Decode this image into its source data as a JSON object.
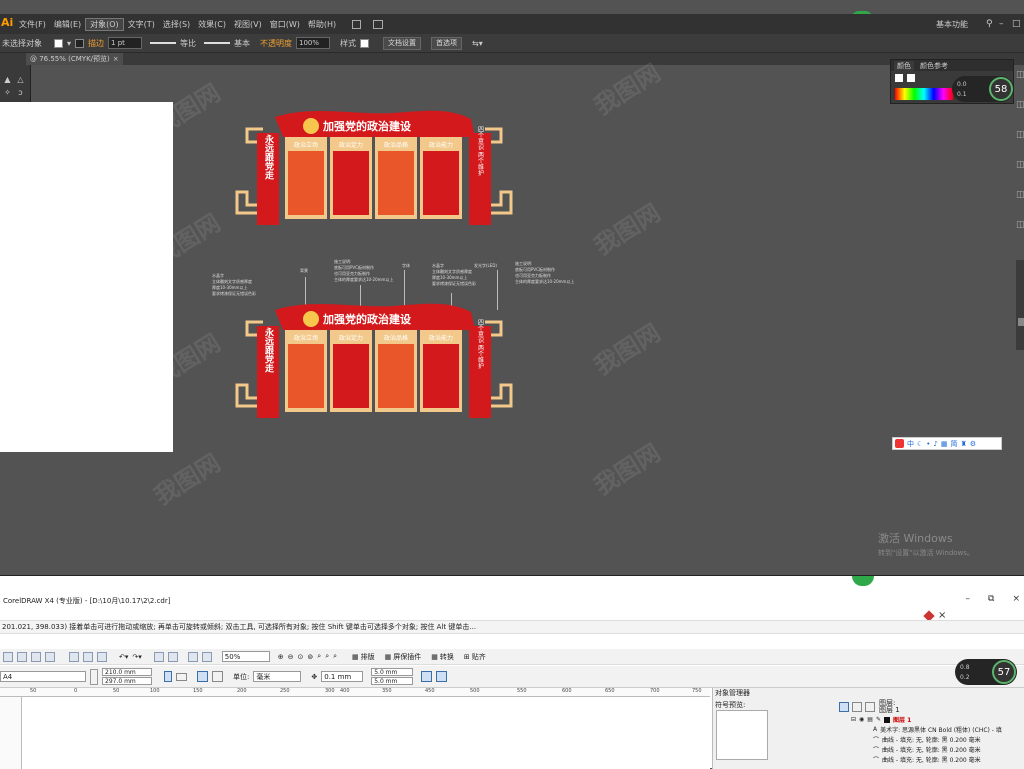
{
  "illustrator": {
    "logo": "Ai",
    "menu": [
      "文件(F)",
      "编辑(E)",
      "对象(O)",
      "文字(T)",
      "选择(S)",
      "效果(C)",
      "视图(V)",
      "窗口(W)",
      "帮助(H)"
    ],
    "workspace": "基本功能",
    "control_bar": {
      "selection": "未选择对象",
      "stroke_label": "描边",
      "stroke_weight": "1 pt",
      "profile": "等比",
      "brush": "基本",
      "opacity_label": "不透明度",
      "opacity_value": "100%",
      "style_label": "样式",
      "doc_setup": "文档设置",
      "prefs": "首选项"
    },
    "doc_tab": "@ 76.55% (CMYK/预览)",
    "panel": {
      "tabs": [
        "颜色",
        "颜色参考"
      ],
      "rows": [
        "0.0",
        "0.1"
      ],
      "gauge": "58"
    },
    "ime_bar": "中",
    "ime_bar_extra": "简",
    "activate": {
      "title": "激活 Windows",
      "subtitle": "转到\"设置\"以激活 Windows。"
    },
    "design": {
      "header": "加强党的政治建设",
      "left_pillar": "永远跟党走",
      "right_pillar": "四个意识 两个维护",
      "panels": [
        "政治立场",
        "政治定力",
        "政治品格",
        "政治能力"
      ]
    },
    "annotations": [
      {
        "text": "水晶字\n立体雕刻文字质感厚度\n厚度10-30mm以上\n要求烤漆保证无错误色彩"
      },
      {
        "text": "背景"
      },
      {
        "text": "施工说明:\n底板可用PVC板材制作\n也可用亚克力板制作\n主体的厚度要求达10-20mm以上"
      },
      {
        "text": "字体"
      },
      {
        "text": "水晶字\n立体雕刻文字质感厚度\n厚度10-30mm以上\n要求烤漆保证无错误色彩"
      },
      {
        "text": "发光字(LED)"
      },
      {
        "text": "施工说明:\n底板可用PVC板材制作\n也可用亚克力板制作\n主体的厚度要求达10-20mm以上"
      }
    ]
  },
  "corel": {
    "title": "CorelDRAW X4 (专业版) - [D:\\10月\\10.17\\2\\2.cdr]",
    "status": "201.021, 398.033)    接着单击可进行拖动或缩放; 再单击可旋转或倾斜; 双击工具, 可选择所有对象; 按住 Shift 键单击可选择多个对象; 按住 Alt 键单击...",
    "zoom": "50%",
    "tb_labels": [
      "排版",
      "屏保插件",
      "转换",
      "贴齐"
    ],
    "page_size": "A4",
    "width": "210.0 mm",
    "height": "297.0 mm",
    "unit_label": "单位:",
    "unit": "毫米",
    "nudge": "0.1 mm",
    "dup_x": "5.0 mm",
    "dup_y": "5.0 mm",
    "ruler_ticks": [
      "50",
      "0",
      "50",
      "100",
      "150",
      "200",
      "250",
      "300",
      "350",
      "400",
      "450",
      "500",
      "550",
      "600",
      "650",
      "700",
      "750"
    ],
    "object_manager": {
      "title": "对象管理器",
      "symbol_search": "符号预览:",
      "layers": [
        "图层:",
        "图层 1"
      ],
      "items": [
        "图层 1",
        "美术字: 思源黑体 CN Bold (粗体) (CHC) - 填",
        "曲线 - 填充: 无, 轮廓: 黑  0.200 毫米",
        "曲线 - 填充: 无, 轮廓: 黑  0.200 毫米",
        "曲线 - 填充: 无, 轮廓: 黑  0.200 毫米"
      ]
    },
    "gauge": "57",
    "gauge_rows": [
      "0.8",
      "0.2"
    ]
  },
  "colors": {
    "red": "#d4191c",
    "orange": "#e8562a",
    "beige": "#f2c98a",
    "dark_red": "#b11116",
    "ui_dark": "#535353"
  }
}
